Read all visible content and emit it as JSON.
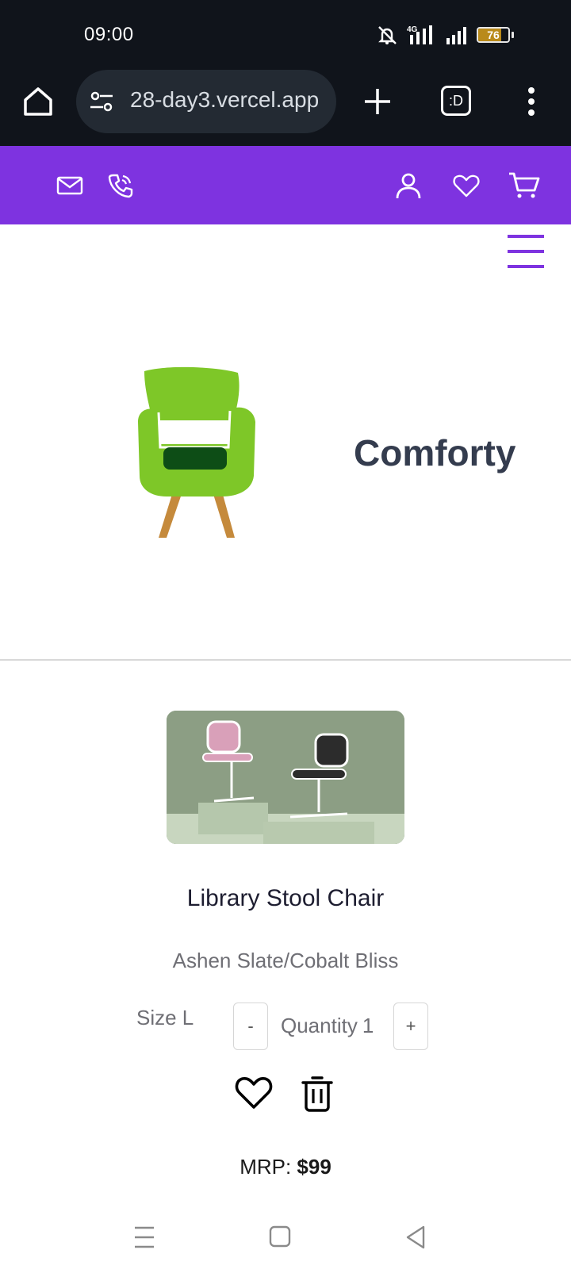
{
  "status_bar": {
    "time": "09:00",
    "network": "4G",
    "battery": "76",
    "battery_fraction": 0.76,
    "icons": [
      "mute-icon",
      "signal-icon",
      "signal-icon",
      "battery-icon"
    ]
  },
  "browser": {
    "url": "28-day3.vercel.app",
    "tabs_label": ":D",
    "icons": [
      "home-icon",
      "tune-icon",
      "plus-icon",
      "more-vert-icon"
    ]
  },
  "header": {
    "background": "#7e33e0",
    "icons": [
      "mail-icon",
      "phone-icon",
      "user-icon",
      "heart-icon",
      "cart-icon"
    ]
  },
  "hero": {
    "brand": "Comforty",
    "image": "green-armchair-logo"
  },
  "product": {
    "name": "Library Stool Chair",
    "color_label": "Ashen Slate/Cobalt Bliss",
    "size_label": "Size L",
    "decrement_label": "-",
    "increment_label": "+",
    "quantity_label": "Quantity",
    "quantity_value": "1",
    "price_label": "MRP:",
    "price_value": "$99"
  },
  "system_nav": {
    "icons": [
      "recents-icon",
      "home-square-icon",
      "back-icon"
    ]
  }
}
